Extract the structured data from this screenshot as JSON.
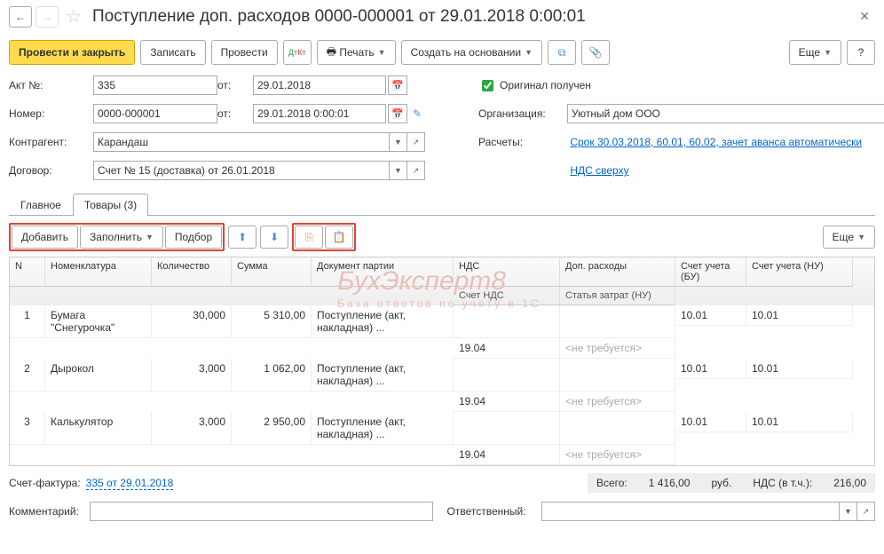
{
  "title": "Поступление доп. расходов 0000-000001 от 29.01.2018 0:00:01",
  "toolbar": {
    "post_close": "Провести и закрыть",
    "save": "Записать",
    "post": "Провести",
    "print": "Печать",
    "create_based": "Создать на основании",
    "more": "Еще"
  },
  "form": {
    "act_label": "Акт №:",
    "act_value": "335",
    "from_label": "от:",
    "act_date": "29.01.2018",
    "original_label": "Оригинал получен",
    "num_label": "Номер:",
    "num_value": "0000-000001",
    "num_date": "29.01.2018  0:00:01",
    "org_label": "Организация:",
    "org_value": "Уютный дом ООО",
    "contr_label": "Контрагент:",
    "contr_value": "Карандаш",
    "calc_label": "Расчеты:",
    "calc_link": "Срок 30.03.2018, 60.01, 60.02, зачет аванса автоматически",
    "contract_label": "Договор:",
    "contract_value": "Счет № 15 (доставка) от 26.01.2018",
    "vat_link": "НДС сверху"
  },
  "tabs": {
    "main": "Главное",
    "goods": "Товары (3)"
  },
  "tbar2": {
    "add": "Добавить",
    "fill": "Заполнить",
    "select": "Подбор",
    "more": "Еще"
  },
  "grid": {
    "cols": {
      "n": "N",
      "item": "Номенклатура",
      "qty": "Количество",
      "sum": "Сумма",
      "batch": "Документ партии",
      "acct_bu": "Счет учета (БУ)",
      "acct_nu": "Счет учета (НУ)",
      "vat": "НДС",
      "extra": "Доп. расходы",
      "vat_acct": "Счет НДС",
      "cost_nu": "Статья затрат (НУ)"
    },
    "rows": [
      {
        "n": "1",
        "item": "Бумага \"Снегурочка\"",
        "qty": "30,000",
        "sum": "5 310,00",
        "batch": "Поступление (акт, накладная) ...",
        "a1": "10.01",
        "a2": "10.01",
        "a3": "19.04",
        "a4": "<не требуется>"
      },
      {
        "n": "2",
        "item": "Дырокол",
        "qty": "3,000",
        "sum": "1 062,00",
        "batch": "Поступление (акт, накладная) ...",
        "a1": "10.01",
        "a2": "10.01",
        "a3": "19.04",
        "a4": "<не требуется>"
      },
      {
        "n": "3",
        "item": "Калькулятор",
        "qty": "3,000",
        "sum": "2 950,00",
        "batch": "Поступление (акт, накладная) ...",
        "a1": "10.01",
        "a2": "10.01",
        "a3": "19.04",
        "a4": "<не требуется>"
      }
    ]
  },
  "footer": {
    "invoice_label": "Счет-фактура:",
    "invoice_link": "335 от 29.01.2018",
    "total_label": "Всего:",
    "total_value": "1 416,00",
    "currency": "руб.",
    "vat_label": "НДС (в т.ч.):",
    "vat_value": "216,00",
    "comment_label": "Комментарий:",
    "responsible_label": "Ответственный:"
  }
}
